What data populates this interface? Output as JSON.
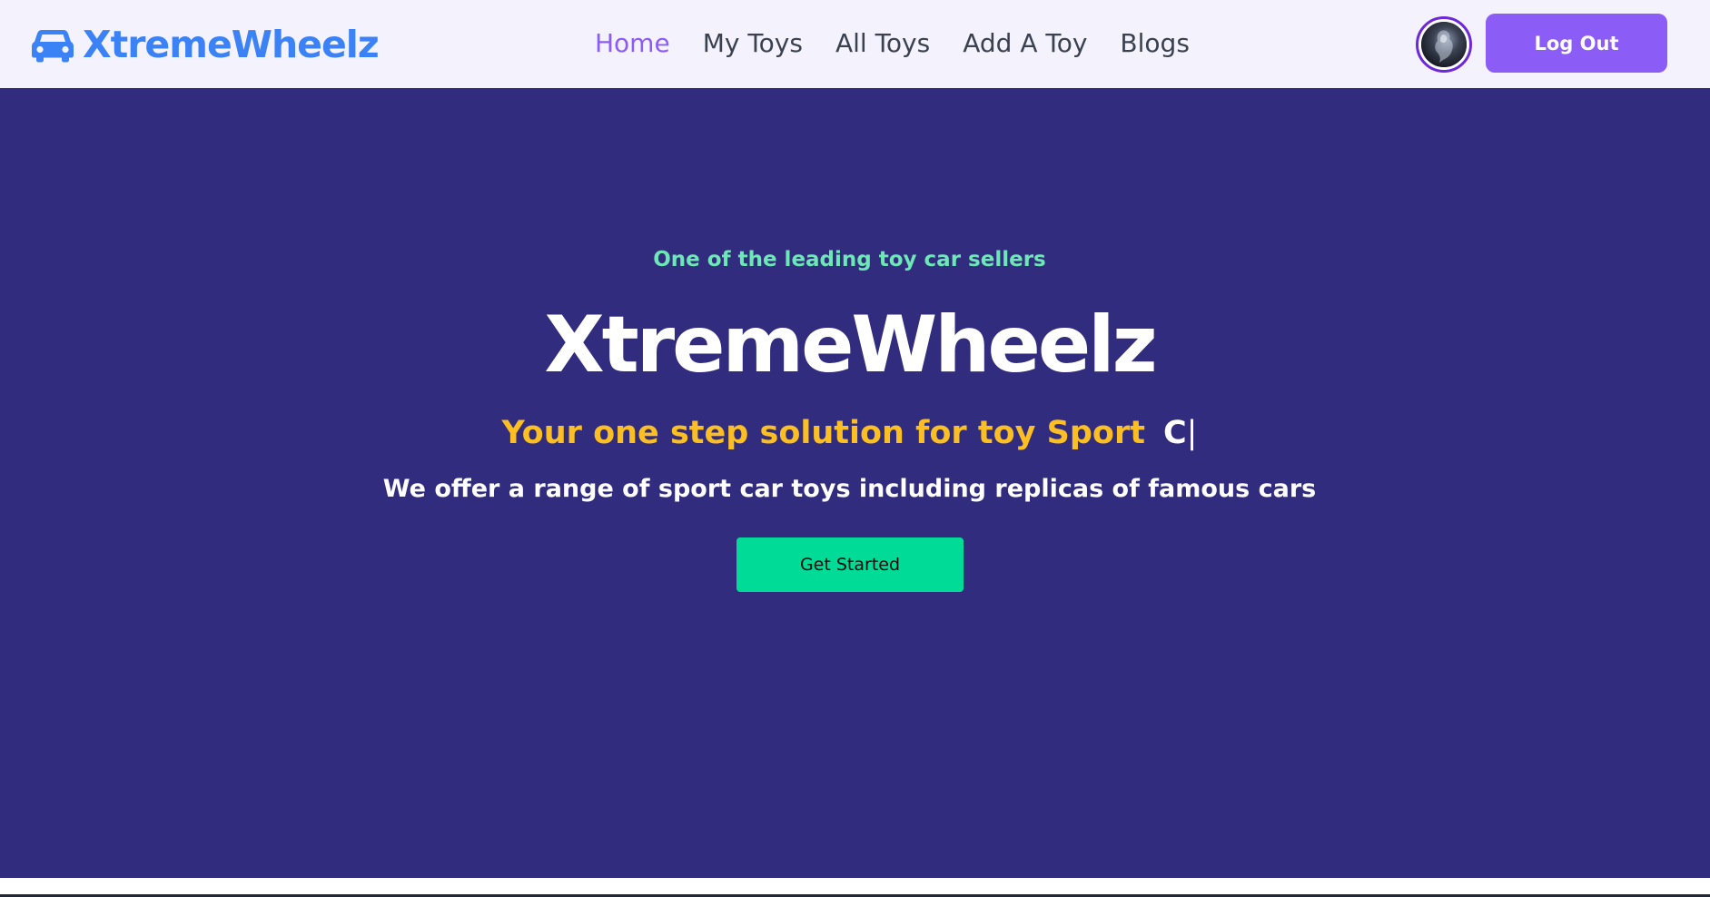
{
  "navbar": {
    "brand": "XtremeWheelz",
    "brand_icon": "car-icon",
    "links": [
      {
        "label": "Home",
        "active": true
      },
      {
        "label": "My Toys",
        "active": false
      },
      {
        "label": "All Toys",
        "active": false
      },
      {
        "label": "Add A Toy",
        "active": false
      },
      {
        "label": "Blogs",
        "active": false
      }
    ],
    "logout_label": "Log Out"
  },
  "hero": {
    "tagline": "One of the leading toy car sellers",
    "title": "XtremeWheelz",
    "typed_static": "Your one step solution for toy Sport",
    "typed_dynamic": "C",
    "typed_cursor": "|",
    "description": "We offer a range of sport car toys including replicas of famous cars",
    "cta_label": "Get Started"
  },
  "colors": {
    "brand": "#3b82f6",
    "accent": "#8b5cf6",
    "hero_bg": "#312c7e",
    "tagline": "#6ee7b7",
    "highlight": "#fbbf24",
    "cta": "#00dc98"
  }
}
